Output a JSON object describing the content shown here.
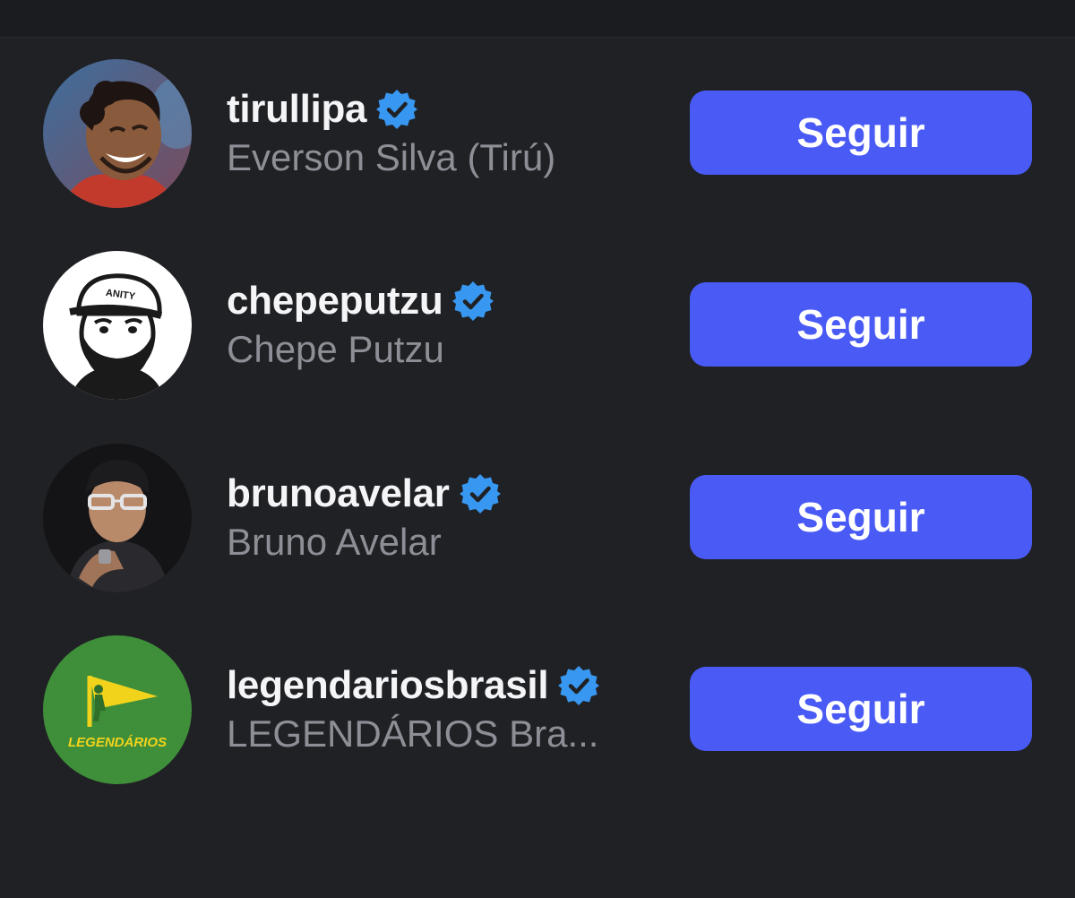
{
  "suggestions": [
    {
      "username": "tirullipa",
      "full_name": "Everson Silva (Tirú)",
      "follow_label": "Seguir",
      "verified": true,
      "avatar_icon": "avatar-photo-man-smiling"
    },
    {
      "username": "chepeputzu",
      "full_name": "Chepe Putzu",
      "follow_label": "Seguir",
      "verified": true,
      "avatar_icon": "avatar-illustration-bearded-man-cap"
    },
    {
      "username": "brunoavelar",
      "full_name": "Bruno Avelar",
      "follow_label": "Seguir",
      "verified": true,
      "avatar_icon": "avatar-photo-man-cap-glasses"
    },
    {
      "username": "legendariosbrasil",
      "full_name": "LEGENDÁRIOS Bra...",
      "follow_label": "Seguir",
      "verified": true,
      "avatar_icon": "avatar-logo-legendarios",
      "avatar_text": "LEGENDÁRIOS"
    }
  ],
  "colors": {
    "background": "#202125",
    "button": "#4a5bf5",
    "verified_badge": "#3897f0",
    "username": "#f5f5f7",
    "full_name": "#8e8f96"
  }
}
